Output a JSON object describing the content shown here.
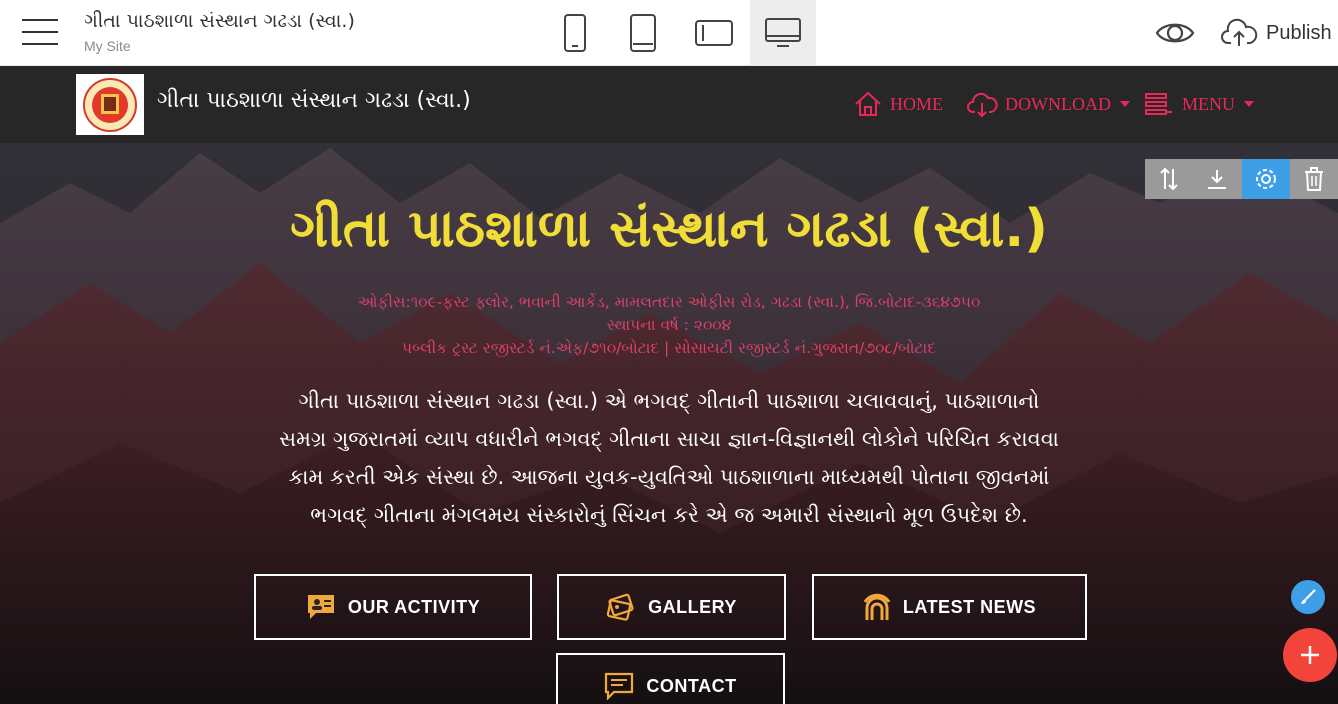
{
  "editor": {
    "site_title": "ગીતા પાઠશાળા સંસ્થાન ગઢડા (સ્વા.)",
    "site_subtitle": "My Site",
    "publish_label": "Publish",
    "active_device": "desktop"
  },
  "navbar": {
    "brand": "ગીતા પાઠશાળા સંસ્થાન ગઢડા (સ્વા.)",
    "accent_color": "#e9285a",
    "items": [
      {
        "label": "HOME",
        "icon": "home-icon"
      },
      {
        "label": "DOWNLOAD",
        "icon": "cloud-download-icon"
      },
      {
        "label": "MENU",
        "icon": "menu-icon"
      }
    ]
  },
  "hero": {
    "title": "ગીતા પાઠશાળા સંસ્થાન ગઢડા (સ્વા.)",
    "title_color": "#f1dd37",
    "sub_lines": [
      "ઓફીસ:૧૦૯-ફસ્ટ ફ્લોર, ભવાની આર્કેડ, મામલતદાર ઓફીસ રોડ, ગઢડા (સ્વા.), જિ.બોટાદ-૩૬૪૭૫૦",
      "સ્થાપના વર્ષ : ૨૦૦૪",
      "પબ્લીક ટ્રસ્ટ રજીસ્ટર્ડ નં.એફ/૭૧૦/બોટાદ | સોસાયટી રજીસ્ટર્ડ નં.ગુજરાત/૭૦૮/બોટાદ"
    ],
    "text_lines": [
      "ગીતા પાઠશાળા સંસ્થાન ગઢડા (સ્વા.) એ ભગવદ્ ગીતાની પાઠશાળા ચલાવવાનું, પાઠશાળાનો",
      "સમગ્ર ગુજરાતમાં વ્યાપ વધારીને ભગવદ્ ગીતાના સાચા જ્ઞાન-વિજ્ઞાનથી લોકોને પરિચિત કરાવવા",
      "કામ કરતી એક સંસ્થા છે. આજના યુવક-યુવતિઓ પાઠશાળાના માધ્યમથી પોતાના જીવનમાં",
      "ભગવદ્ ગીતાના મંગલમય સંસ્કારોનું સિંચન કરે એ જ અમારી સંસ્થાનો મૂળ ઉપદેશ છે."
    ],
    "buttons": [
      {
        "label": "OUR ACTIVITY",
        "icon": "activity-icon"
      },
      {
        "label": "GALLERY",
        "icon": "gallery-icon"
      },
      {
        "label": "LATEST NEWS",
        "icon": "rss-icon"
      },
      {
        "label": "CONTACT",
        "icon": "chat-icon"
      }
    ],
    "button_icon_color": "#f2a93b"
  },
  "block_tools": [
    {
      "icon": "move-icon"
    },
    {
      "icon": "download-icon"
    },
    {
      "icon": "settings-icon"
    },
    {
      "icon": "trash-icon"
    }
  ]
}
